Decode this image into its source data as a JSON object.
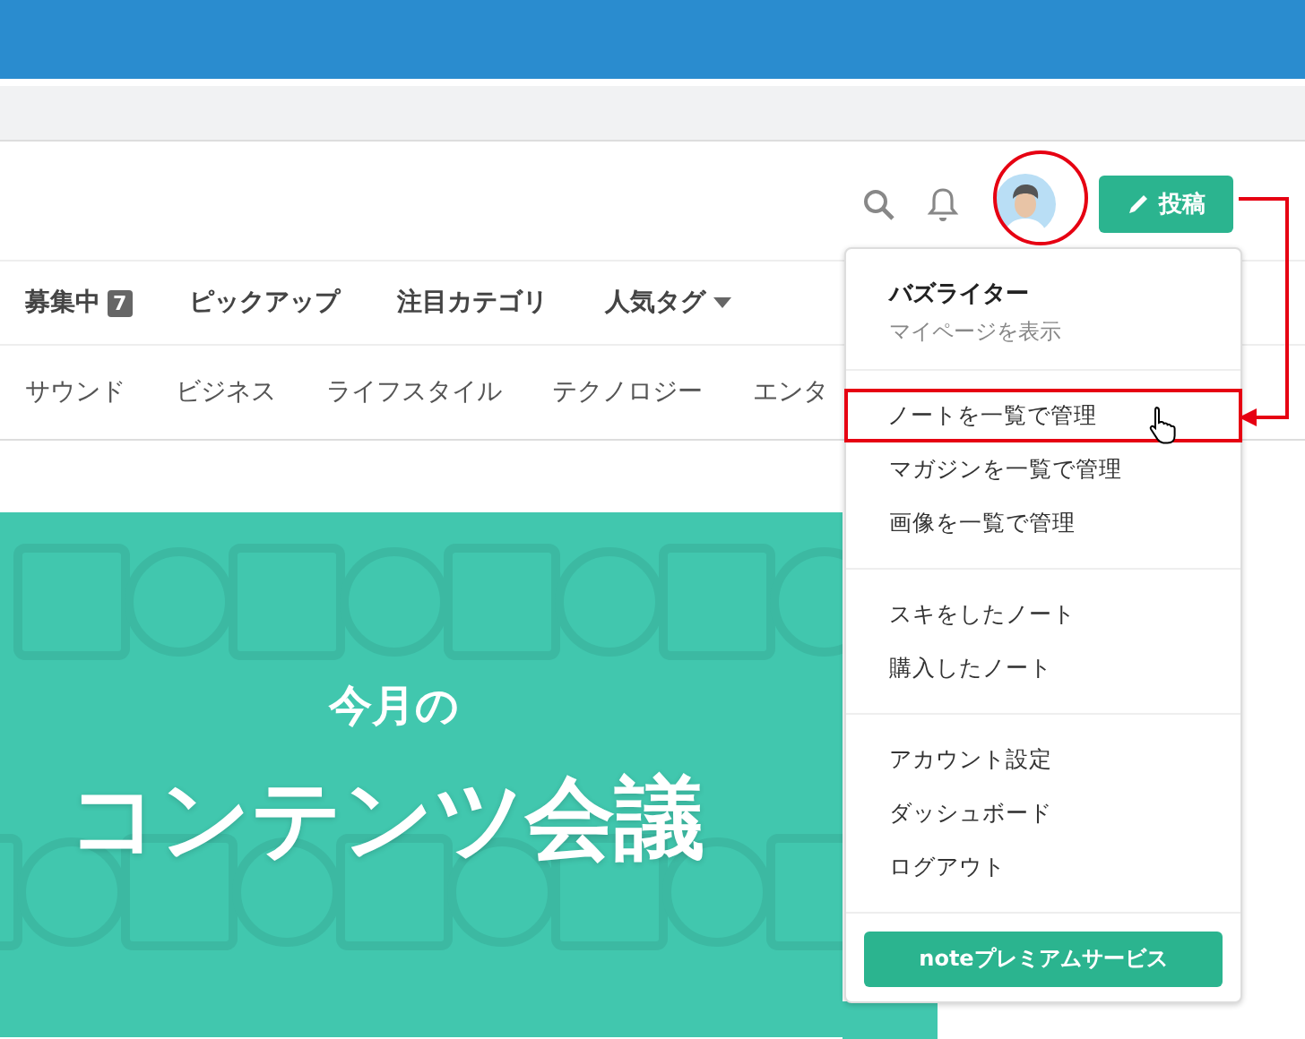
{
  "header": {
    "post_button": "投稿"
  },
  "nav": [
    {
      "label": "募集中",
      "badge": "7",
      "kind": "badge"
    },
    {
      "label": "ピックアップ",
      "kind": "plain"
    },
    {
      "label": "注目カテゴリ",
      "kind": "plain"
    },
    {
      "label": "人気タグ",
      "kind": "dropdown"
    }
  ],
  "categories": [
    "サウンド",
    "ビジネス",
    "ライフスタイル",
    "テクノロジー",
    "エンタ"
  ],
  "banner": {
    "kind": "picture",
    "subtitle": "今月の",
    "title": "コンテンツ会議"
  },
  "menu": {
    "user": {
      "name": "バズライター",
      "link": "マイページを表示"
    },
    "groups": [
      [
        {
          "label": "ノートを一覧で管理",
          "highlighted": true
        },
        {
          "label": "マガジンを一覧で管理",
          "highlighted": false
        },
        {
          "label": "画像を一覧で管理",
          "highlighted": false
        }
      ],
      [
        {
          "label": "スキをしたノート",
          "highlighted": false
        },
        {
          "label": "購入したノート",
          "highlighted": false
        }
      ],
      [
        {
          "label": "アカウント設定",
          "highlighted": false
        },
        {
          "label": "ダッシュボード",
          "highlighted": false
        },
        {
          "label": "ログアウト",
          "highlighted": false
        }
      ]
    ],
    "premium_button": "noteプレミアムサービス"
  }
}
